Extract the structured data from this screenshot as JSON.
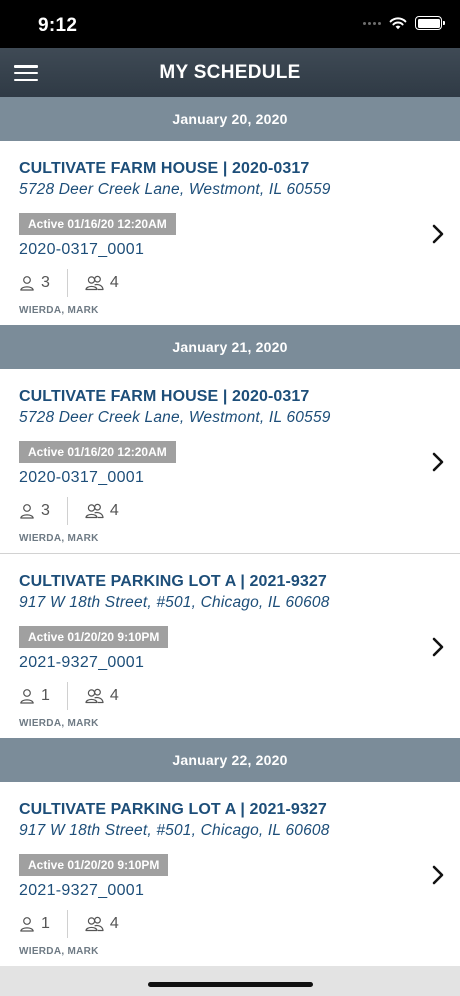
{
  "status_bar": {
    "time": "9:12"
  },
  "nav": {
    "title": "MY SCHEDULE"
  },
  "schedule": [
    {
      "date": "January 20, 2020",
      "items": [
        {
          "title": "CULTIVATE FARM HOUSE | 2020-0317",
          "address": "5728 Deer Creek Lane, Westmont, IL 60559",
          "status": "Active 01/16/20 12:20AM",
          "code": "2020-0317_0001",
          "person_count": "3",
          "group_count": "4",
          "assignee": "WIERDA, MARK"
        }
      ]
    },
    {
      "date": "January 21, 2020",
      "items": [
        {
          "title": "CULTIVATE FARM HOUSE | 2020-0317",
          "address": "5728 Deer Creek Lane, Westmont, IL 60559",
          "status": "Active 01/16/20 12:20AM",
          "code": "2020-0317_0001",
          "person_count": "3",
          "group_count": "4",
          "assignee": "WIERDA, MARK"
        },
        {
          "title": "CULTIVATE PARKING LOT A | 2021-9327",
          "address": "917 W 18th Street, #501, Chicago, IL 60608",
          "status": "Active 01/20/20 9:10PM",
          "code": "2021-9327_0001",
          "person_count": "1",
          "group_count": "4",
          "assignee": "WIERDA, MARK"
        }
      ]
    },
    {
      "date": "January 22, 2020",
      "items": [
        {
          "title": "CULTIVATE PARKING LOT A | 2021-9327",
          "address": "917 W 18th Street, #501, Chicago, IL 60608",
          "status": "Active 01/20/20 9:10PM",
          "code": "2021-9327_0001",
          "person_count": "1",
          "group_count": "4",
          "assignee": "WIERDA, MARK"
        }
      ]
    }
  ],
  "icons": {
    "menu": "hamburger-icon",
    "person": "person-icon",
    "group": "group-icon",
    "chevron": "chevron-right-icon"
  },
  "colors": {
    "nav_background": "#36414c",
    "date_header": "#7b8c99",
    "title_text": "#1d4e79",
    "badge": "#a0a0a0"
  }
}
